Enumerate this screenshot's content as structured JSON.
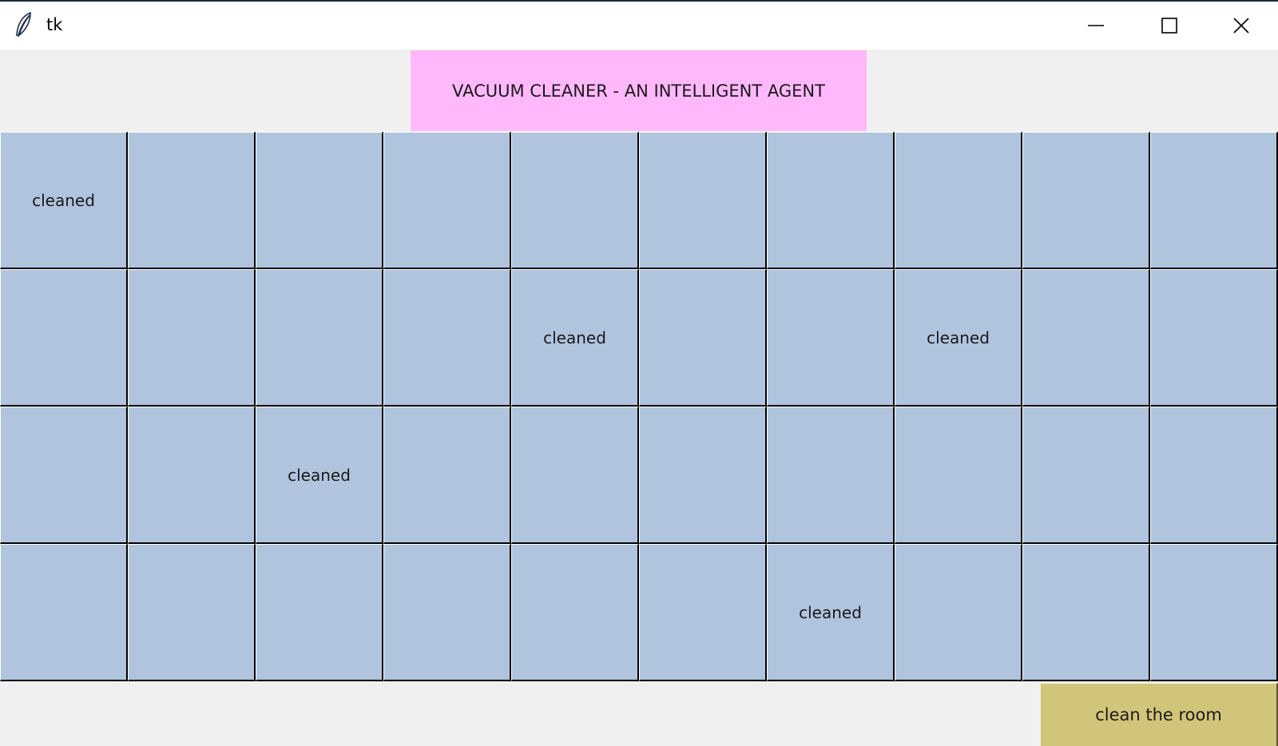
{
  "window": {
    "title": "tk",
    "icon": "tk-feather-icon",
    "controls": {
      "minimize_icon": "minimize-icon",
      "maximize_icon": "maximize-icon",
      "close_icon": "close-icon"
    }
  },
  "banner": {
    "text": "VACUUM CLEANER - AN INTELLIGENT AGENT",
    "color": "#ffb8fb"
  },
  "room": {
    "rows": 4,
    "cols": 10,
    "cell_color": "#b0c4de",
    "cells": [
      [
        "cleaned",
        "",
        "",
        "",
        "",
        "",
        "",
        "",
        "",
        ""
      ],
      [
        "",
        "",
        "",
        "",
        "cleaned",
        "",
        "",
        "cleaned",
        "",
        ""
      ],
      [
        "",
        "",
        "cleaned",
        "",
        "",
        "",
        "",
        "",
        "",
        ""
      ],
      [
        "",
        "",
        "",
        "",
        "",
        "",
        "cleaned",
        "",
        "",
        ""
      ]
    ]
  },
  "actions": {
    "clean_button": "clean the room",
    "clean_button_color": "#d1c579"
  }
}
